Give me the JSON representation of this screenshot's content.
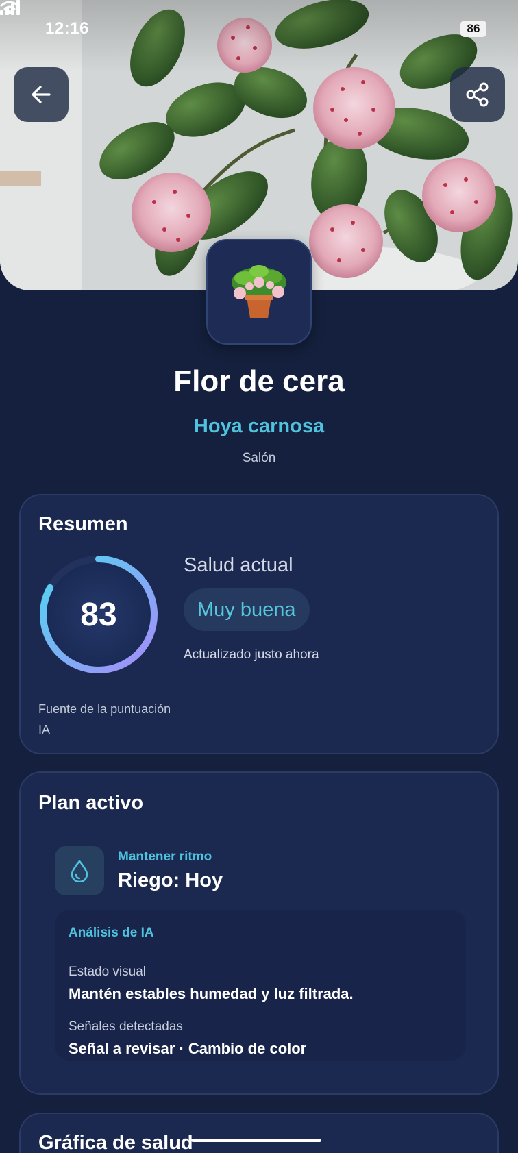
{
  "status_bar": {
    "time": "12:16",
    "battery": "86"
  },
  "header": {
    "back_icon": "arrow-left-icon",
    "share_icon": "share-icon"
  },
  "plant": {
    "name": "Flor de cera",
    "species": "Hoya carnosa",
    "room": "Salón"
  },
  "summary": {
    "title": "Resumen",
    "score": "83",
    "score_fraction": 0.83,
    "health_label": "Salud actual",
    "health_status": "Muy buena",
    "updated": "Actualizado justo ahora",
    "source_label": "Fuente de la puntuación",
    "source_value": "IA"
  },
  "plan": {
    "title": "Plan activo",
    "task_icon": "water-drop-icon",
    "task_eyebrow": "Mantener ritmo",
    "task_title": "Riego: Hoy",
    "ai": {
      "title": "Análisis de IA",
      "visual_label": "Estado visual",
      "visual_value": "Mantén estables humedad y luz filtrada.",
      "signals_label": "Señales detectadas",
      "signals_value": "Señal a revisar · Cambio de color"
    }
  },
  "chart_section": {
    "title": "Gráfica de salud"
  },
  "colors": {
    "background": "#14203d",
    "card": "#1b2850",
    "accent": "#4fc3de",
    "gauge_start": "#a78bfa",
    "gauge_end": "#4fd7f0"
  }
}
